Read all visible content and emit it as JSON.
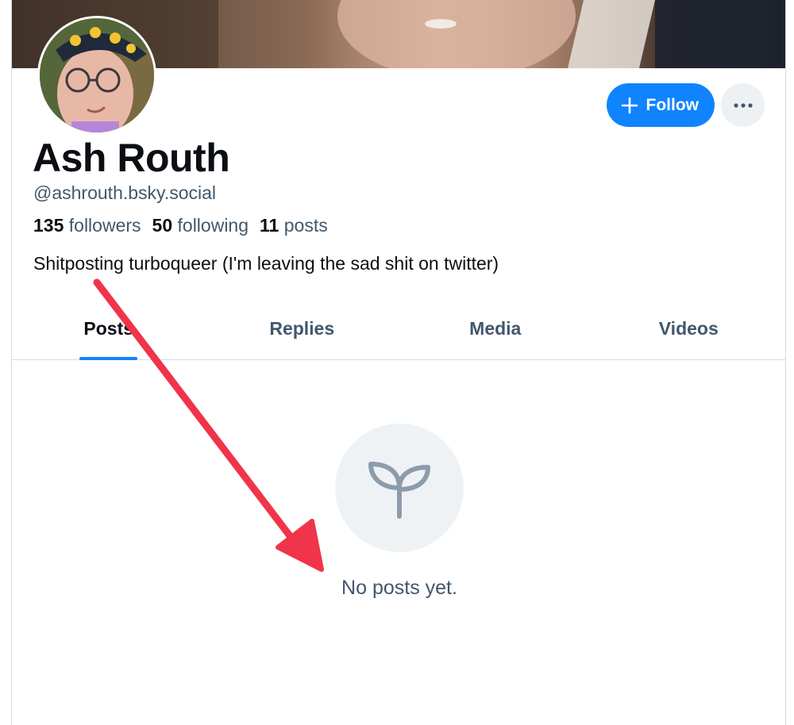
{
  "profile": {
    "display_name": "Ash Routh",
    "handle": "@ashrouth.bsky.social",
    "followers_count": "135",
    "followers_label": "followers",
    "following_count": "50",
    "following_label": "following",
    "posts_count": "11",
    "posts_label": "posts",
    "bio": "Shitposting turboqueer (I'm leaving the sad shit on twitter)"
  },
  "actions": {
    "follow_label": "Follow",
    "follow_icon": "plus-icon",
    "more_icon": "ellipsis-icon"
  },
  "tabs": [
    {
      "label": "Posts",
      "active": true
    },
    {
      "label": "Replies",
      "active": false
    },
    {
      "label": "Media",
      "active": false
    },
    {
      "label": "Videos",
      "active": false
    }
  ],
  "empty_state": {
    "icon": "sprout-icon",
    "message": "No posts yet."
  },
  "colors": {
    "accent": "#1083fe",
    "annotation_arrow": "#f0344a",
    "muted_text": "#42576c"
  }
}
